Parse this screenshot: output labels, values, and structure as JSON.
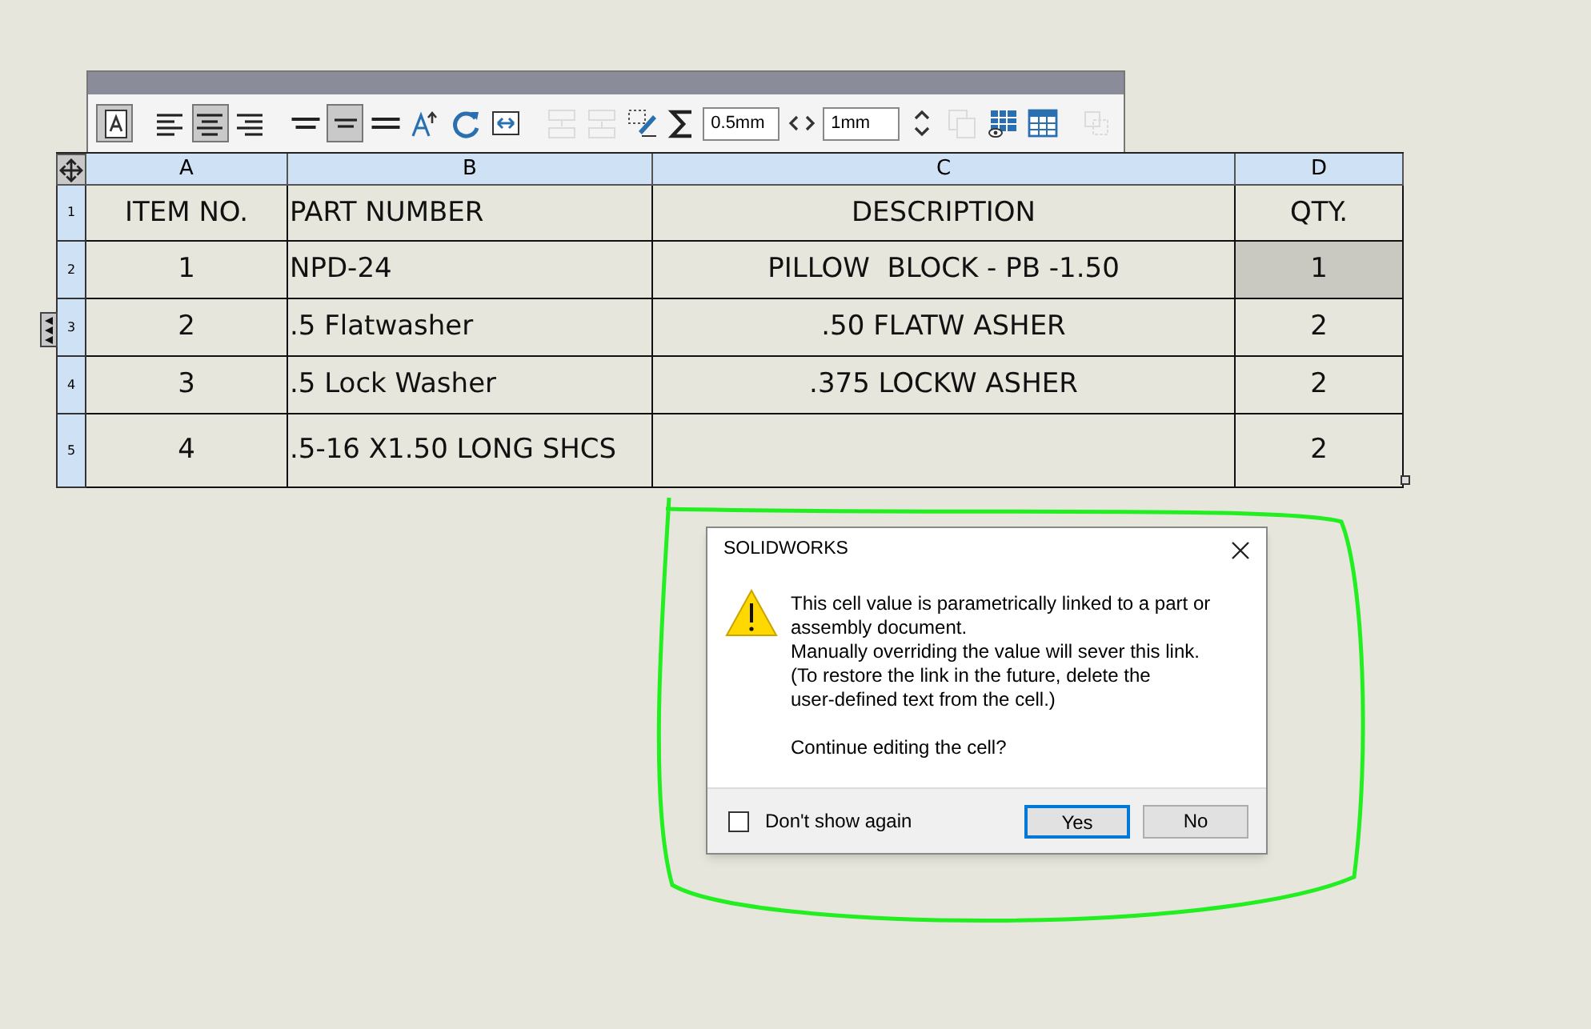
{
  "toolbar": {
    "items": [
      {
        "kind": "button",
        "selected": true,
        "disabled": false
      },
      {
        "kind": "gap"
      },
      {
        "kind": "button",
        "selected": false,
        "disabled": false
      },
      {
        "kind": "button",
        "selected": true,
        "disabled": false
      },
      {
        "kind": "button",
        "selected": false,
        "disabled": false
      },
      {
        "kind": "gap"
      },
      {
        "kind": "button",
        "selected": false,
        "disabled": false
      },
      {
        "kind": "button",
        "selected": true,
        "disabled": false
      },
      {
        "kind": "button",
        "selected": false,
        "disabled": false
      },
      {
        "kind": "button",
        "selected": false,
        "disabled": false
      },
      {
        "kind": "button",
        "selected": false,
        "disabled": false
      },
      {
        "kind": "button",
        "selected": false,
        "disabled": false
      },
      {
        "kind": "gap"
      },
      {
        "kind": "button",
        "selected": false,
        "disabled": true
      },
      {
        "kind": "button",
        "selected": false,
        "disabled": true
      },
      {
        "kind": "button",
        "selected": false,
        "disabled": false
      },
      {
        "kind": "button",
        "selected": false,
        "disabled": false
      },
      {
        "kind": "field",
        "value": "0.5mm"
      },
      {
        "kind": "button",
        "selected": false,
        "disabled": false
      },
      {
        "kind": "field",
        "value": "1mm"
      },
      {
        "kind": "button",
        "selected": false,
        "disabled": false
      },
      {
        "kind": "button",
        "selected": false,
        "disabled": true
      },
      {
        "kind": "button",
        "selected": false,
        "disabled": false
      },
      {
        "kind": "button",
        "selected": false,
        "disabled": false
      },
      {
        "kind": "gap"
      },
      {
        "kind": "button",
        "selected": false,
        "disabled": true
      }
    ]
  },
  "table": {
    "columns": [
      "A",
      "B",
      "C",
      "D"
    ],
    "rows": [
      {
        "number": "1",
        "cells": [
          {
            "text": "ITEM NO.",
            "selected": false
          },
          {
            "text": "PART NUMBER",
            "selected": false
          },
          {
            "text": "DESCRIPTION",
            "selected": false
          },
          {
            "text": "QTY.",
            "selected": false
          }
        ]
      },
      {
        "number": "2",
        "cells": [
          {
            "text": "1",
            "selected": false
          },
          {
            "text": "NPD-24",
            "selected": false
          },
          {
            "text": "PILLOW  BLOCK - PB -1.50",
            "selected": false
          },
          {
            "text": "1",
            "selected": true
          }
        ]
      },
      {
        "number": "3",
        "cells": [
          {
            "text": "2",
            "selected": false
          },
          {
            "text": ".5 Flatwasher",
            "selected": false
          },
          {
            "text": ".50 FLATW ASHER",
            "selected": false
          },
          {
            "text": "2",
            "selected": false
          }
        ]
      },
      {
        "number": "4",
        "cells": [
          {
            "text": "3",
            "selected": false
          },
          {
            "text": ".5 Lock Washer",
            "selected": false
          },
          {
            "text": ".375 LOCKW ASHER",
            "selected": false
          },
          {
            "text": "2",
            "selected": false
          }
        ]
      },
      {
        "number": "5",
        "cells": [
          {
            "text": "4",
            "selected": false
          },
          {
            "text": ".5-16 X1.50 LONG SHCS",
            "selected": false
          },
          {
            "text": "",
            "selected": false
          },
          {
            "text": "2",
            "selected": false
          }
        ]
      }
    ]
  },
  "dialog": {
    "title": "SOLIDWORKS",
    "message_lines": [
      "This cell value is parametrically linked to a part or",
      "assembly document.",
      "Manually overriding the value will sever this link.",
      "(To restore the link in the future, delete the",
      "user-defined text from the cell.)"
    ],
    "question": "Continue editing the cell?",
    "checkbox": {
      "label": "Don't show again",
      "checked": false
    },
    "buttons": [
      {
        "label": "Yes",
        "selected": true
      },
      {
        "label": "No",
        "selected": false
      }
    ]
  }
}
